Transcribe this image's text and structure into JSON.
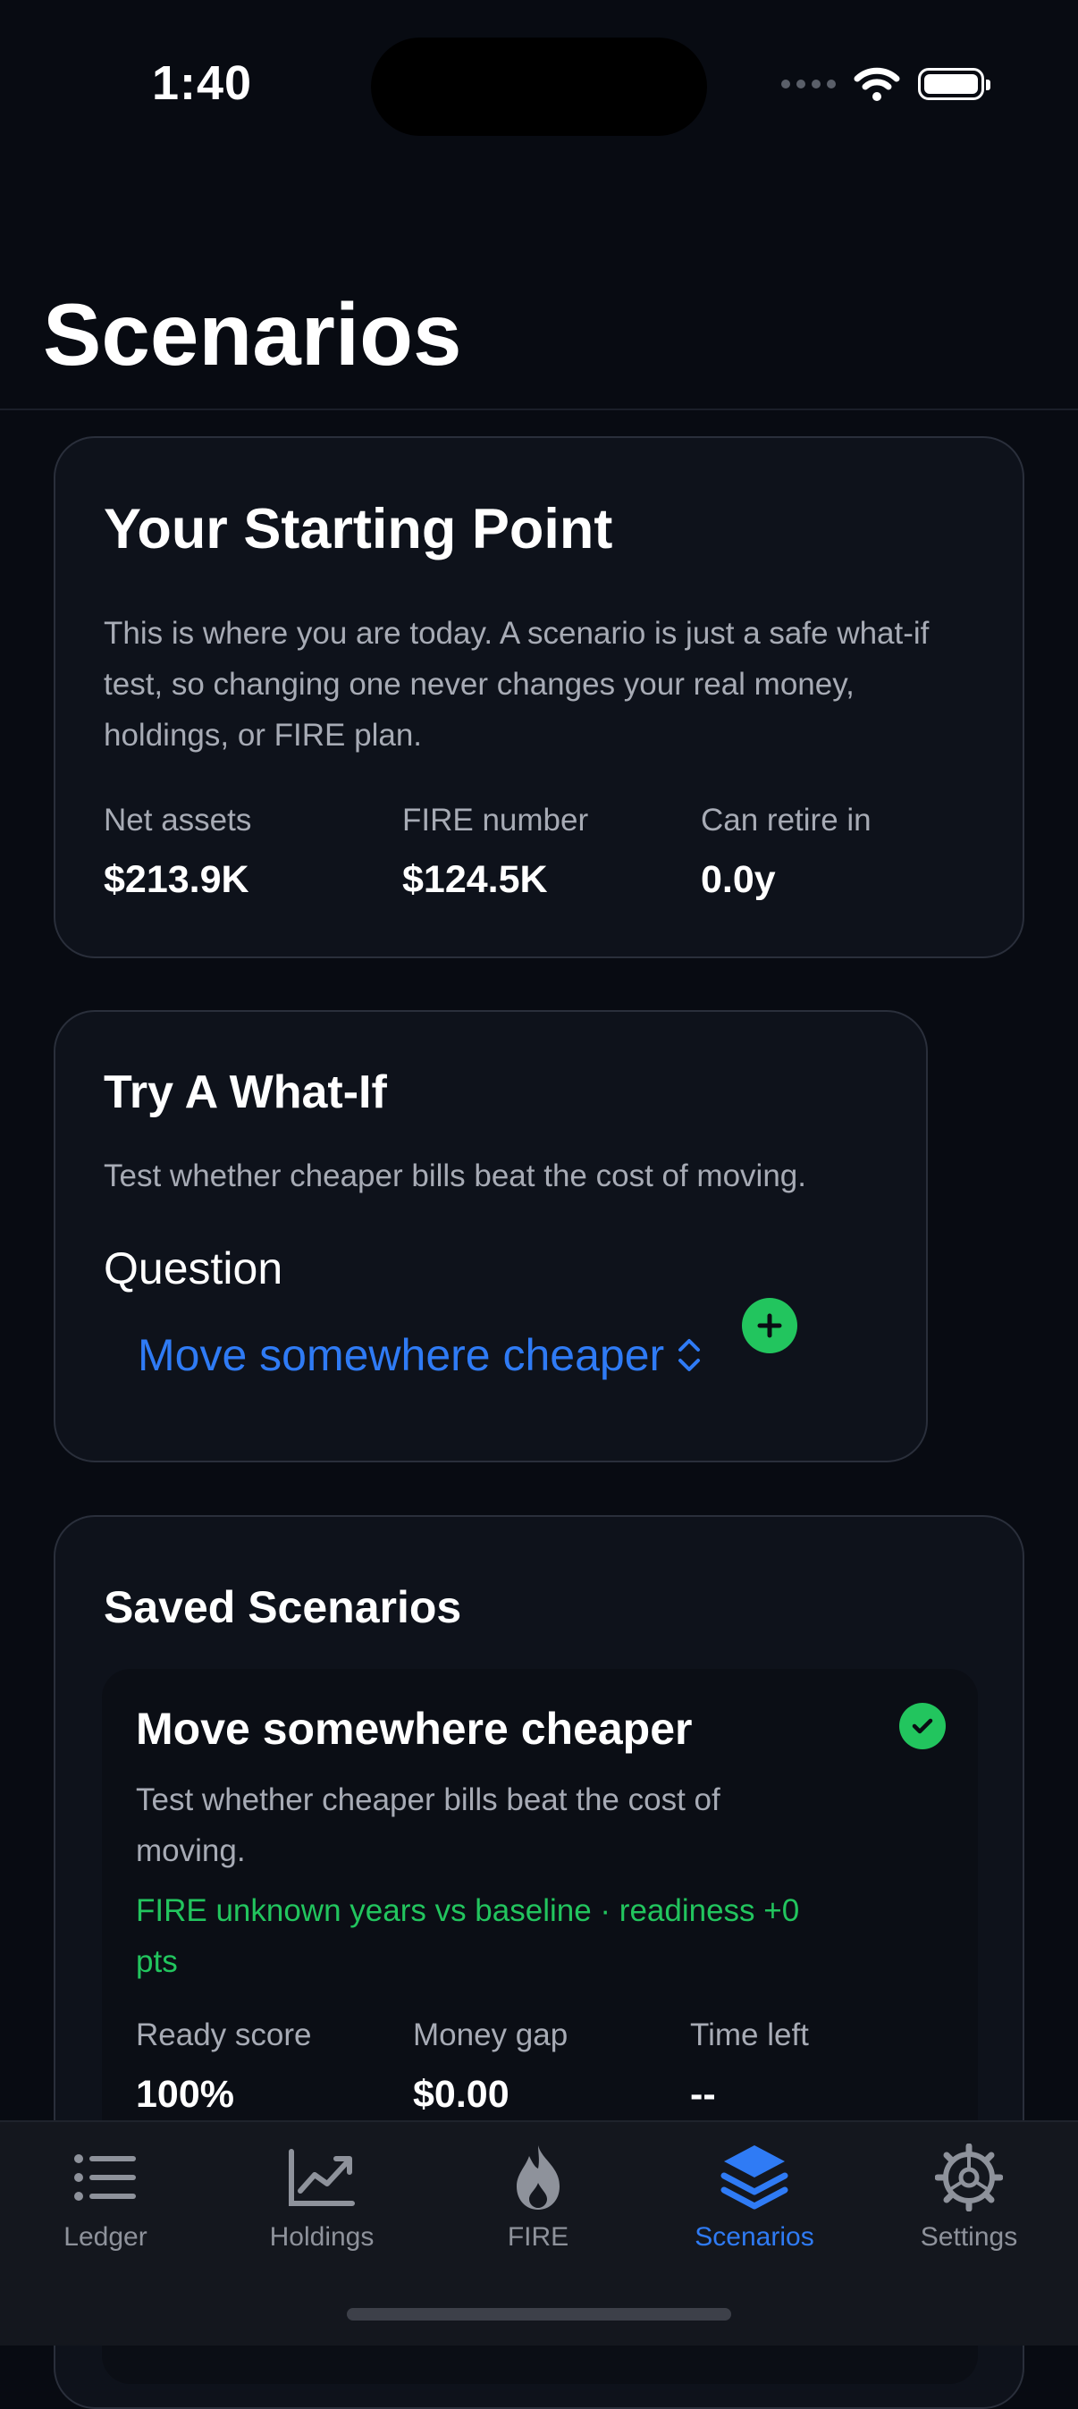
{
  "status_bar": {
    "time": "1:40"
  },
  "page": {
    "title": "Scenarios"
  },
  "starting_point": {
    "heading": "Your Starting Point",
    "description": "This is where you are today. A scenario is just a safe what-if test, so changing one never changes your real money, holdings, or FIRE plan.",
    "stats": [
      {
        "label": "Net assets",
        "value": "$213.9K"
      },
      {
        "label": "FIRE number",
        "value": "$124.5K"
      },
      {
        "label": "Can retire in",
        "value": "0.0y"
      }
    ]
  },
  "what_if": {
    "heading": "Try A What-If",
    "description": "Test whether cheaper bills beat the cost of moving.",
    "question_label": "Question",
    "selected_question": "Move somewhere cheaper"
  },
  "saved": {
    "heading": "Saved Scenarios",
    "item": {
      "title": "Move somewhere cheaper",
      "description": "Test whether cheaper bills beat the cost of moving.",
      "delta": "FIRE unknown years vs baseline · readiness +0 pts",
      "stats": [
        {
          "label": "Ready score",
          "value": "100%"
        },
        {
          "label": "Money gap",
          "value": "$0.00"
        },
        {
          "label": "Time left",
          "value": "--"
        }
      ]
    }
  },
  "tabs": [
    {
      "label": "Ledger",
      "icon": "list-icon"
    },
    {
      "label": "Holdings",
      "icon": "chart-icon"
    },
    {
      "label": "FIRE",
      "icon": "flame-icon"
    },
    {
      "label": "Scenarios",
      "icon": "layers-icon",
      "active": true
    },
    {
      "label": "Settings",
      "icon": "gear-icon"
    }
  ],
  "colors": {
    "accent": "#2f7bf5",
    "positive": "#22c55e",
    "background": "#080b12"
  }
}
